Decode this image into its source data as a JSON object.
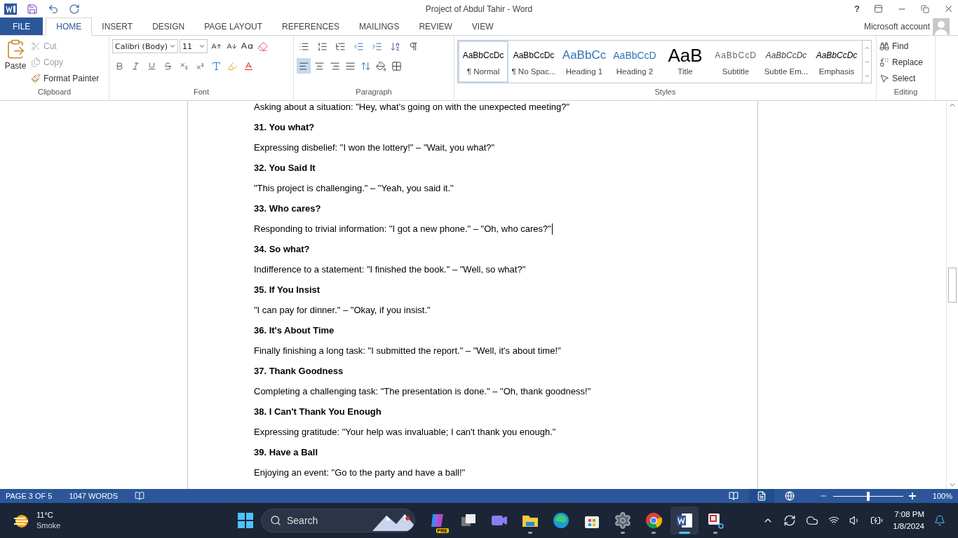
{
  "title_bar": {
    "title": "Project of Abdul Tahir - Word",
    "help": "?"
  },
  "tabs": [
    {
      "label": "FILE",
      "kind": "file",
      "selected": false
    },
    {
      "label": "HOME",
      "kind": "tab",
      "selected": true
    },
    {
      "label": "INSERT",
      "kind": "tab",
      "selected": false
    },
    {
      "label": "DESIGN",
      "kind": "tab",
      "selected": false
    },
    {
      "label": "PAGE LAYOUT",
      "kind": "tab",
      "selected": false
    },
    {
      "label": "REFERENCES",
      "kind": "tab",
      "selected": false
    },
    {
      "label": "MAILINGS",
      "kind": "tab",
      "selected": false
    },
    {
      "label": "REVIEW",
      "kind": "tab",
      "selected": false
    },
    {
      "label": "VIEW",
      "kind": "tab",
      "selected": false
    }
  ],
  "account": "Microsoft account",
  "clipboard": {
    "group": "Clipboard",
    "paste": "Paste",
    "items": [
      {
        "label": "Cut",
        "kind": "cut",
        "disabled": true
      },
      {
        "label": "Copy",
        "kind": "copy",
        "disabled": true
      },
      {
        "label": "Format Painter",
        "kind": "painter",
        "disabled": false
      }
    ]
  },
  "font": {
    "group": "Font",
    "name": "Calibri (Body)",
    "size": "11"
  },
  "paragraph": {
    "group": "Paragraph",
    "alignments": [
      {
        "kind": "left",
        "selected": true
      },
      {
        "kind": "center",
        "selected": false
      },
      {
        "kind": "right",
        "selected": false
      },
      {
        "kind": "justify",
        "selected": false
      }
    ]
  },
  "styles": {
    "group": "Styles",
    "items": [
      {
        "preview": "AaBbCcDc",
        "label": "¶ Normal",
        "kind": "normal",
        "selected": true
      },
      {
        "preview": "AaBbCcDc",
        "label": "¶ No Spac...",
        "kind": "normal",
        "selected": false
      },
      {
        "preview": "AaBbCc",
        "label": "Heading 1",
        "kind": "heading1",
        "selected": false
      },
      {
        "preview": "AaBbCcD",
        "label": "Heading 2",
        "kind": "heading2",
        "selected": false
      },
      {
        "preview": "AaB",
        "label": "Title",
        "kind": "title",
        "selected": false
      },
      {
        "preview": "AaBbCcD",
        "label": "Subtitle",
        "kind": "subtitle",
        "selected": false
      },
      {
        "preview": "AaBbCcDc",
        "label": "Subtle Em...",
        "kind": "subtle",
        "selected": false
      },
      {
        "preview": "AaBbCcDc",
        "label": "Emphasis",
        "kind": "emphasis",
        "selected": false
      }
    ]
  },
  "editing": {
    "group": "Editing",
    "items": [
      {
        "label": "Find",
        "kind": "find"
      },
      {
        "label": "Replace",
        "kind": "replace"
      },
      {
        "label": "Select",
        "kind": "select"
      }
    ]
  },
  "document": {
    "lines": [
      {
        "kind": "body",
        "text": "Asking about a situation: \"Hey, what's going on with the unexpected meeting?\"",
        "cursor": false
      },
      {
        "kind": "heading",
        "text": "31. You what?",
        "cursor": false
      },
      {
        "kind": "body",
        "text": "Expressing disbelief: \"I won the lottery!\" – \"Wait, you what?\"",
        "cursor": false
      },
      {
        "kind": "heading",
        "text": "32. You Said It",
        "cursor": false
      },
      {
        "kind": "body",
        "text": "\"This project is challenging.\" – \"Yeah, you said it.\"",
        "cursor": false
      },
      {
        "kind": "heading",
        "text": "33. Who cares?",
        "cursor": false
      },
      {
        "kind": "body",
        "text": "Responding to trivial information: \"I got a new phone.\" – \"Oh, who cares?\"",
        "cursor": true
      },
      {
        "kind": "heading",
        "text": "34. So what?",
        "cursor": false
      },
      {
        "kind": "body",
        "text": "Indifference to a statement: \"I finished the book.\" – \"Well, so what?\"",
        "cursor": false
      },
      {
        "kind": "heading",
        "text": "35. If You Insist",
        "cursor": false
      },
      {
        "kind": "body",
        "text": "\"I can pay for dinner.\" – \"Okay, if you insist.\"",
        "cursor": false
      },
      {
        "kind": "heading",
        "text": "36. It's About Time",
        "cursor": false
      },
      {
        "kind": "body",
        "text": "Finally finishing a long task: \"I submitted the report.\" – \"Well, it's about time!\"",
        "cursor": false
      },
      {
        "kind": "heading",
        "text": "37. Thank Goodness",
        "cursor": false
      },
      {
        "kind": "body",
        "text": "Completing a challenging task: \"The presentation is done.\" – \"Oh, thank goodness!\"",
        "cursor": false
      },
      {
        "kind": "heading",
        "text": "38. I Can't Thank You Enough",
        "cursor": false
      },
      {
        "kind": "body",
        "text": "Expressing gratitude: \"Your help was invaluable; I can't thank you enough.\"",
        "cursor": false
      },
      {
        "kind": "heading",
        "text": "39. Have a Ball",
        "cursor": false
      },
      {
        "kind": "body",
        "text": "Enjoying an event: \"Go to the party and have a ball!\"",
        "cursor": false
      }
    ]
  },
  "status_bar": {
    "page": "PAGE 3 OF 5",
    "words": "1047 WORDS",
    "views": [
      {
        "kind": "read",
        "selected": false
      },
      {
        "kind": "print",
        "selected": true
      },
      {
        "kind": "web",
        "selected": false
      }
    ],
    "zoom": {
      "level": 0.5,
      "reading": "100%"
    }
  },
  "taskbar": {
    "weather": {
      "temp": "11°C",
      "condition": "Smoke"
    },
    "search": {
      "placeholder": "Search"
    },
    "apps": [
      {
        "kind": "copilot",
        "badge": "PRE",
        "running": false,
        "active": false
      },
      {
        "kind": "taskview",
        "running": false,
        "active": false
      },
      {
        "kind": "meet",
        "running": false,
        "active": false
      },
      {
        "kind": "explorer",
        "running": true,
        "active": false
      },
      {
        "kind": "edge",
        "running": false,
        "active": false
      },
      {
        "kind": "store",
        "running": false,
        "active": false
      },
      {
        "kind": "settings",
        "running": true,
        "active": false
      },
      {
        "kind": "chrome",
        "running": true,
        "active": false
      },
      {
        "kind": "word",
        "running": true,
        "active": true
      },
      {
        "kind": "snip",
        "running": true,
        "active": false
      }
    ],
    "time": "7:08 PM",
    "date": "1/8/2024"
  }
}
